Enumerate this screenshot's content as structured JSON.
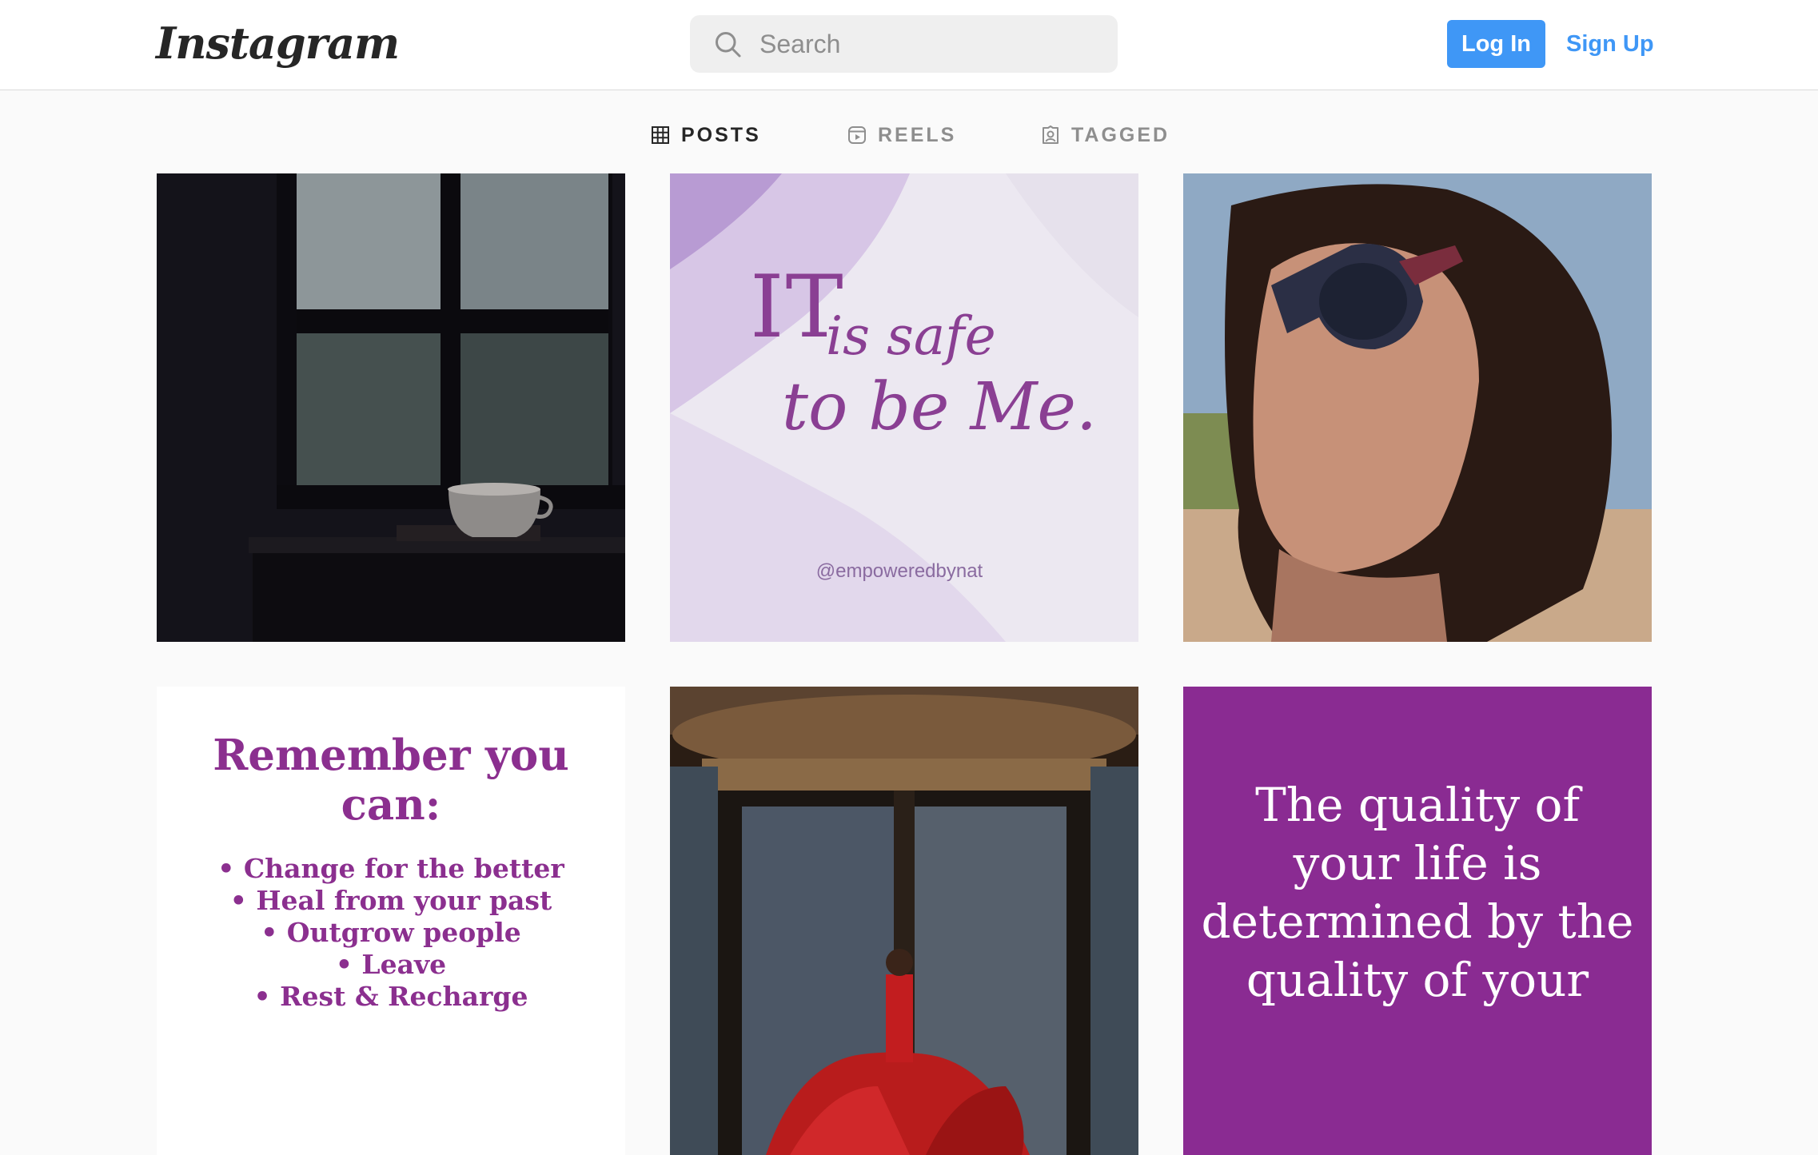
{
  "header": {
    "logo_text": "Instagram",
    "search_placeholder": "Search",
    "login_label": "Log In",
    "signup_label": "Sign Up"
  },
  "tabs": [
    {
      "label": "POSTS",
      "icon": "grid-icon",
      "active": true
    },
    {
      "label": "REELS",
      "icon": "reels-icon",
      "active": false
    },
    {
      "label": "TAGGED",
      "icon": "tagged-icon",
      "active": false
    }
  ],
  "posts": [
    {
      "kind": "photo",
      "subject": "rainy window with cup"
    },
    {
      "kind": "quote",
      "line1": "IT",
      "line2": "is safe",
      "line3": "to be Me.",
      "handle": "@empoweredbynat"
    },
    {
      "kind": "photo",
      "subject": "woman with sunglasses"
    },
    {
      "kind": "quote",
      "title": "Remember you can:",
      "items": [
        "• Change for the better",
        "• Heal from your past",
        "• Outgrow people",
        "• Leave",
        "• Rest & Recharge"
      ]
    },
    {
      "kind": "photo",
      "subject": "woman in red dress in revolving door"
    },
    {
      "kind": "quote",
      "text": "The quality of your life is determined by the quality of your"
    }
  ],
  "colors": {
    "accent": "#3f97f6",
    "purple_text": "#8b2f8f",
    "purple_bg": "#8a2b92"
  }
}
